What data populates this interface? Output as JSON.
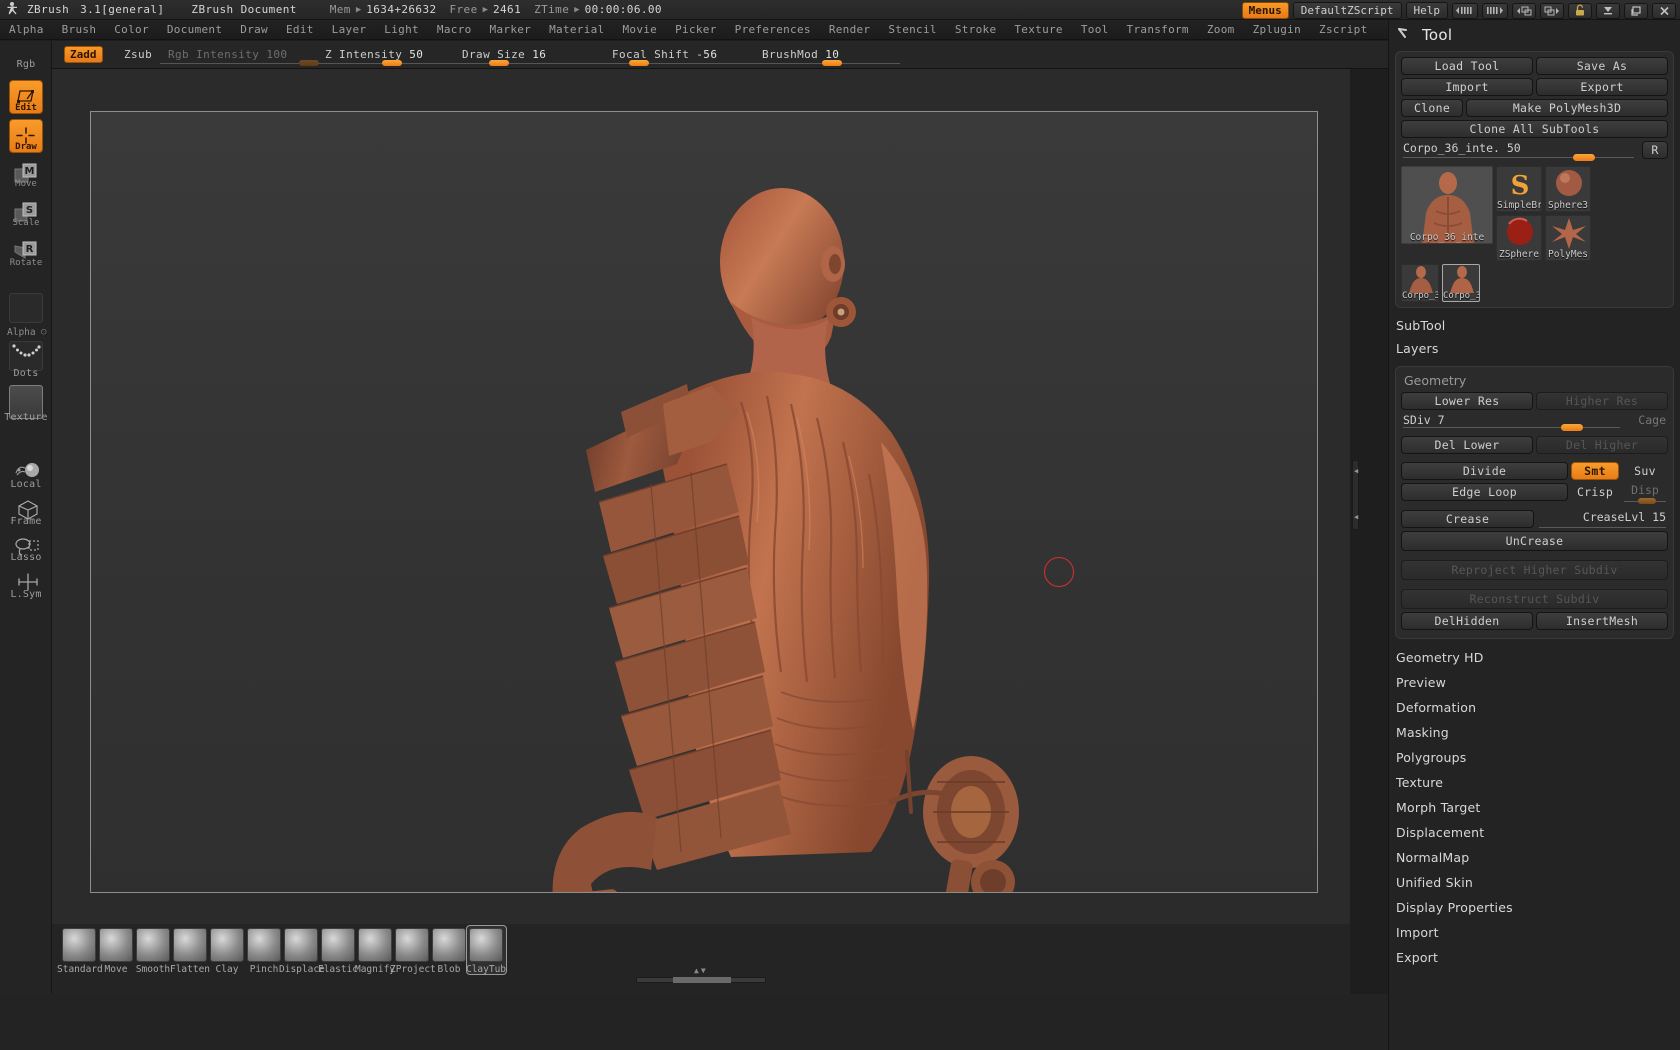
{
  "titlebar": {
    "app_name": "ZBrush",
    "version": "3.1[general]",
    "doc_name": "ZBrush Document",
    "mem_label": "Mem",
    "mem_value": "1634+26632",
    "free_label": "Free",
    "free_value": "2461",
    "ztime_label": "ZTime",
    "ztime_value": "00:00:06.00",
    "menus_button": "Menus",
    "zscript_button": "DefaultZScript",
    "help_button": "Help",
    "icons": [
      "scroll-left-icon",
      "scroll-right-icon",
      "prev-window-icon",
      "next-window-icon",
      "lock-icon",
      "minimize-icon",
      "restore-icon",
      "close-icon"
    ]
  },
  "menubar": {
    "items": [
      "Alpha",
      "Brush",
      "Color",
      "Document",
      "Draw",
      "Edit",
      "Layer",
      "Light",
      "Macro",
      "Marker",
      "Material",
      "Movie",
      "Picker",
      "Preferences",
      "Render",
      "Stencil",
      "Stroke",
      "Texture",
      "Tool",
      "Transform",
      "Zoom",
      "Zplugin",
      "Zscript"
    ]
  },
  "paramsbar": {
    "rgb_label": "Rgb",
    "zadd_label": "Zadd",
    "zsub_label": "Zsub",
    "sliders": [
      {
        "name": "rgb-intensity",
        "label": "Rgb Intensity",
        "value": "100",
        "enabled": false,
        "fill": 98
      },
      {
        "name": "z-intensity",
        "label": "Z Intensity",
        "value": "50",
        "enabled": true,
        "fill": 50
      },
      {
        "name": "draw-size",
        "label": "Draw Size",
        "value": "16",
        "enabled": true,
        "fill": 28
      },
      {
        "name": "focal-shift",
        "label": "Focal Shift",
        "value": "-56",
        "enabled": true,
        "fill": 22
      },
      {
        "name": "brushmod",
        "label": "BrushMod",
        "value": "10",
        "enabled": true,
        "fill": 55
      }
    ]
  },
  "left_toolbar": {
    "rgb_label": "Rgb",
    "transform_tools": [
      {
        "name": "edit",
        "label": "Edit",
        "active": true,
        "icon": "edit-icon"
      },
      {
        "name": "draw",
        "label": "Draw",
        "active": true,
        "icon": "draw-icon"
      },
      {
        "name": "move",
        "label": "Move",
        "active": false,
        "icon": "move-icon"
      },
      {
        "name": "scale",
        "label": "Scale",
        "active": false,
        "icon": "scale-icon"
      },
      {
        "name": "rotate",
        "label": "Rotate",
        "active": false,
        "icon": "rotate-icon"
      }
    ],
    "alpha_label": "Alpha",
    "stroke_label": "Dots",
    "texture_label": "Texture",
    "view_tools": [
      {
        "name": "local",
        "label": "Local",
        "icon": "local-icon"
      },
      {
        "name": "frame",
        "label": "Frame",
        "icon": "frame-cube-icon"
      },
      {
        "name": "lasso",
        "label": "Lasso",
        "icon": "lasso-icon"
      },
      {
        "name": "lsym",
        "label": "L.Sym",
        "icon": "local-symmetry-icon"
      }
    ]
  },
  "canvas": {
    "cursor_label": "brush-ring-cursor",
    "model_name": "Corpo_36_inte"
  },
  "tool_panel": {
    "title": "Tool",
    "title_icon": "hammer-icon",
    "buttons": {
      "load_tool": "Load Tool",
      "save_as": "Save As",
      "import": "Import",
      "export": "Export",
      "clone": "Clone",
      "make_polymesh3d": "Make PolyMesh3D",
      "clone_all_subtools": "Clone All SubTools"
    },
    "item_slider": {
      "label": "Corpo_36_inte. 50",
      "reset_label": "R",
      "fill": 82
    },
    "thumbnails": {
      "selected_big": "Corpo_36_inte",
      "grid": [
        {
          "name": "simplebrush",
          "label": "SimpleBr"
        },
        {
          "name": "sphere3d",
          "label": "Sphere3"
        },
        {
          "name": "zsphere",
          "label": "ZSphere"
        },
        {
          "name": "polymesh3d",
          "label": "PolyMes"
        }
      ],
      "recent": [
        {
          "name": "corpo-a",
          "label": "Corpo_3",
          "selected": false
        },
        {
          "name": "corpo-b",
          "label": "Corpo_3",
          "selected": true
        }
      ]
    },
    "sections": [
      {
        "name": "subtool",
        "label": "SubTool"
      },
      {
        "name": "layers",
        "label": "Layers"
      }
    ],
    "geometry": {
      "header": "Geometry",
      "lower_res": "Lower Res",
      "higher_res": "Higher Res",
      "sdiv": {
        "label": "SDiv 7",
        "cage_label": "Cage",
        "fill": 82
      },
      "del_lower": "Del Lower",
      "del_higher": "Del Higher",
      "divide": "Divide",
      "smt": "Smt",
      "suv": "Suv",
      "edge_loop": "Edge Loop",
      "crisp": "Crisp",
      "disp": {
        "label": "Disp",
        "fill": 42
      },
      "crease": "Crease",
      "creaselvl": {
        "label": "CreaseLvl 15",
        "fill": 74
      },
      "uncrease": "UnCrease",
      "reproject_higher_subdiv": "Reproject Higher Subdiv",
      "reconstruct_subdiv": "Reconstruct Subdiv",
      "del_hidden": "DelHidden",
      "insert_mesh": "InsertMesh"
    },
    "menu_items": [
      "Geometry HD",
      "Preview",
      "Deformation",
      "Masking",
      "Polygroups",
      "Texture",
      "Morph Target",
      "Displacement",
      "NormalMap",
      "Unified Skin",
      "Display Properties",
      "Import",
      "Export"
    ]
  },
  "brush_strip": {
    "brushes": [
      {
        "name": "standard",
        "label": "Standard",
        "selected": false
      },
      {
        "name": "move",
        "label": "Move",
        "selected": false
      },
      {
        "name": "smooth",
        "label": "Smooth",
        "selected": false
      },
      {
        "name": "flatten",
        "label": "Flatten",
        "selected": false
      },
      {
        "name": "clay",
        "label": "Clay",
        "selected": false
      },
      {
        "name": "pinch",
        "label": "Pinch",
        "selected": false
      },
      {
        "name": "displace",
        "label": "Displace",
        "selected": false
      },
      {
        "name": "elastic",
        "label": "Elastic",
        "selected": false
      },
      {
        "name": "magnify",
        "label": "Magnify",
        "selected": false
      },
      {
        "name": "zproject",
        "label": "ZProject",
        "selected": false
      },
      {
        "name": "blob",
        "label": "Blob",
        "selected": false
      },
      {
        "name": "claytubes",
        "label": "ClayTub",
        "selected": true
      }
    ]
  },
  "colors": {
    "accent_orange": "#ec7d15",
    "panel_bg": "#2b2b2b",
    "app_bg": "#232323",
    "canvas_bg": "#343434",
    "text": "#cfcfcf",
    "clay_red": "#b05f43"
  }
}
